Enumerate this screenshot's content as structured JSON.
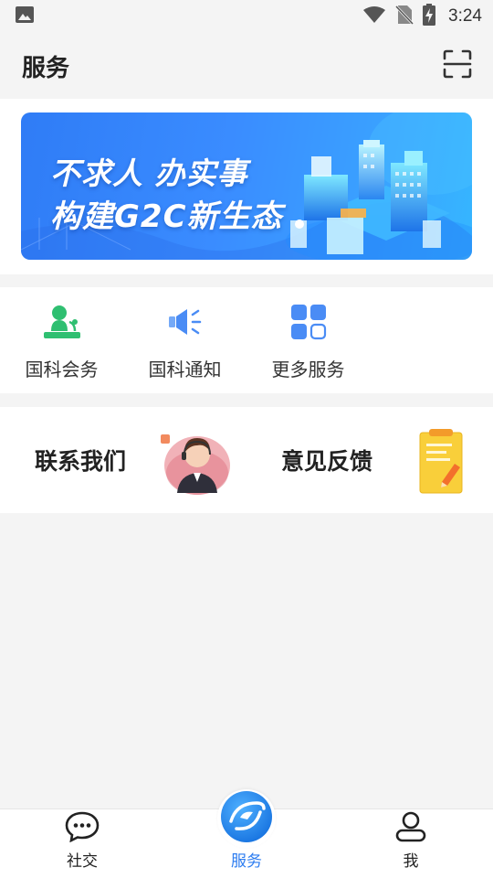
{
  "status_bar": {
    "time": "3:24",
    "icons": [
      "image-icon",
      "wifi-icon",
      "no-sim-icon",
      "battery-charging-icon"
    ]
  },
  "header": {
    "title": "服务",
    "scan_icon": "scan-icon"
  },
  "banner": {
    "line1": "不求人 办实事",
    "line2": "构建G2C新生态"
  },
  "services": [
    {
      "label": "国科会务",
      "icon": "conference-icon",
      "color": "#2fbf71"
    },
    {
      "label": "国科通知",
      "icon": "megaphone-icon",
      "color": "#4a8cf5"
    },
    {
      "label": "更多服务",
      "icon": "grid-icon",
      "color": "#4a8cf5"
    }
  ],
  "contact": {
    "contact_us": "联系我们",
    "feedback": "意见反馈"
  },
  "bottom_nav": {
    "items": [
      {
        "label": "社交",
        "icon": "chat-bubble-icon"
      },
      {
        "label": "服务",
        "icon": "service-logo-icon",
        "active": true
      },
      {
        "label": "我",
        "icon": "user-icon"
      }
    ],
    "active_color": "#2c7cf0"
  }
}
